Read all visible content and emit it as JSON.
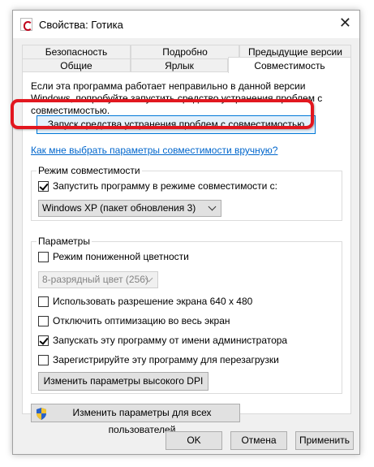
{
  "window": {
    "title": "Свойства: Готика",
    "close_glyph": "✕"
  },
  "tabs": {
    "row1": [
      "Безопасность",
      "Подробно",
      "Предыдущие версии"
    ],
    "row2": [
      "Общие",
      "Ярлык",
      "Совместимость"
    ],
    "active": "Совместимость"
  },
  "compat": {
    "description": "Если эта программа работает неправильно в данной версии Windows, попробуйте запустить средство устранения проблем с совместимостью.",
    "troubleshoot_button": "Запуск средства устранения проблем с совместимостью",
    "help_link": "Как мне выбрать параметры совместимости вручную?"
  },
  "compat_mode": {
    "group_title": "Режим совместимости",
    "checkbox_label": "Запустить программу в режиме совместимости с:",
    "checked": true,
    "selected_os": "Windows XP (пакет обновления 3)"
  },
  "settings": {
    "group_title": "Параметры",
    "reduced_color": {
      "label": "Режим пониженной цветности",
      "checked": false
    },
    "color_select": "8-разрядный цвет (256)",
    "res_640": {
      "label": "Использовать разрешение экрана 640 x 480",
      "checked": false
    },
    "fullscreen_opt": {
      "label": "Отключить оптимизацию во весь экран",
      "checked": false
    },
    "run_admin": {
      "label": "Запускать эту программу от имени администратора",
      "checked": true
    },
    "register_restart": {
      "label": "Зарегистрируйте эту программу для перезагрузки",
      "checked": false
    },
    "high_dpi_button": "Изменить параметры высокого DPI"
  },
  "all_users_button": "Изменить параметры для всех пользователей",
  "footer": {
    "ok": "OK",
    "cancel": "Отмена",
    "apply": "Применить"
  },
  "colors": {
    "highlight": "#e2171f",
    "link": "#0066cc",
    "focus_border": "#0078d7"
  }
}
